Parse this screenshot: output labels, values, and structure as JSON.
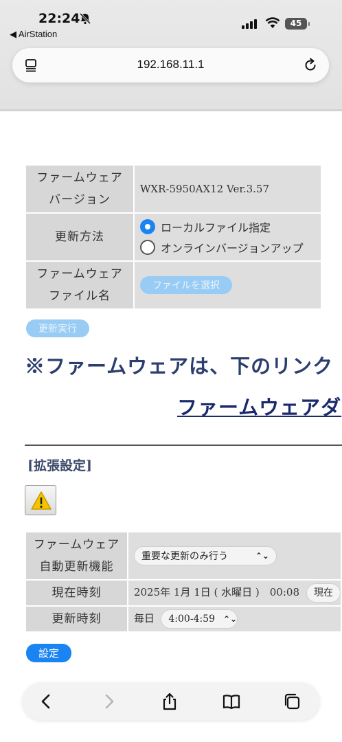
{
  "status_bar": {
    "time": "22:24",
    "back_app": "◀ AirStation",
    "battery": "45"
  },
  "browser": {
    "url": "192.168.11.1"
  },
  "firmware_table": {
    "version_label": [
      "ファームウェア",
      "バージョン"
    ],
    "version_value": "WXR-5950AX12 Ver.3.57",
    "method_label": "更新方法",
    "method_options": [
      {
        "label": "ローカルファイル指定",
        "selected": true
      },
      {
        "label": "オンラインバージョンアップ",
        "selected": false
      }
    ],
    "file_label": [
      "ファームウェア",
      "ファイル名"
    ],
    "file_button": "ファイルを選択"
  },
  "execute_button": "更新実行",
  "notice_text": "※ファームウェアは、下のリンク",
  "firmware_link": "ファームウェアダ",
  "extended_section": {
    "title": "[拡張設定]",
    "auto_update_label": [
      "ファームウェア",
      "自動更新機能"
    ],
    "auto_update_value": "重要な更新のみ行う",
    "current_time_label": "現在時刻",
    "current_time_value": "2025年 1月 1日 ( 水曜日 )　00:08",
    "current_time_button": "現在",
    "update_time_label": "更新時刻",
    "update_time_prefix": "毎日",
    "update_time_value": "4:00-4:59",
    "save_button": "設定"
  },
  "colors": {
    "accent": "#1a84f2",
    "disabled_button": "#98ccf5",
    "heading": "#2c3e6e",
    "table_label_bg": "#d7d7d7"
  }
}
